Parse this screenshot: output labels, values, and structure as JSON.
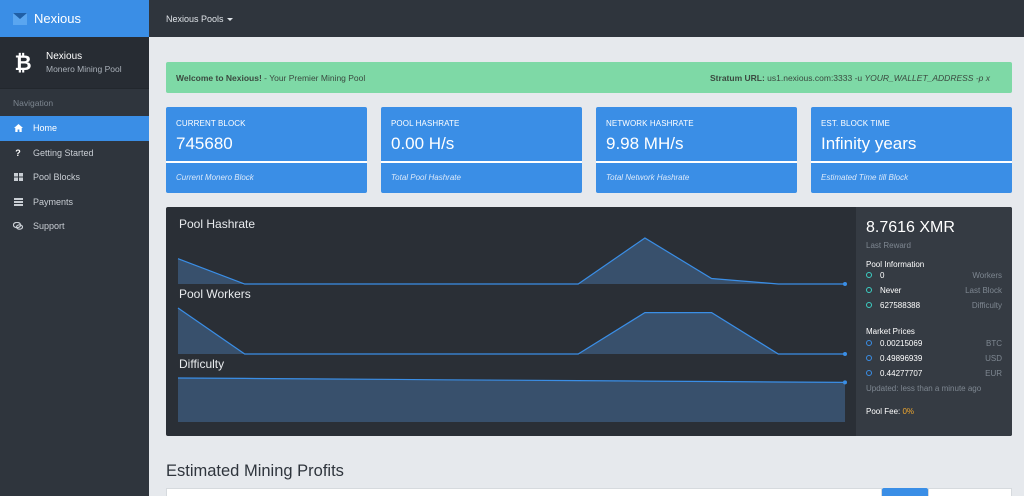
{
  "app": {
    "brand": "Nexious",
    "brand_icon": "logo-icon"
  },
  "profile": {
    "name": "Nexious",
    "subtitle": "Monero Mining Pool",
    "icon": "bitcoin-icon"
  },
  "nav": {
    "heading": "Navigation",
    "items": [
      {
        "label": "Home",
        "icon": "home-icon",
        "active": true
      },
      {
        "label": "Getting Started",
        "icon": "question-icon",
        "active": false
      },
      {
        "label": "Pool Blocks",
        "icon": "blocks-icon",
        "active": false
      },
      {
        "label": "Payments",
        "icon": "payments-icon",
        "active": false
      },
      {
        "label": "Support",
        "icon": "support-icon",
        "active": false
      }
    ]
  },
  "topbar": {
    "pools_label": "Nexious Pools"
  },
  "alert": {
    "welcome_bold": "Welcome to Nexious!",
    "welcome_text": " - Your Premier Mining Pool",
    "stratum_label": "Stratum URL:",
    "stratum_url": " us1.nexious.com:3333 -u ",
    "stratum_wallet": "YOUR_WALLET_ADDRESS",
    "stratum_tail": " -p x"
  },
  "cards": [
    {
      "title": "CURRENT BLOCK",
      "value": "745680",
      "footer": "Current Monero Block"
    },
    {
      "title": "POOL HASHRATE",
      "value": "0.00 H/s",
      "footer": "Total Pool Hashrate"
    },
    {
      "title": "NETWORK HASHRATE",
      "value": "9.98 MH/s",
      "footer": "Total Network Hashrate"
    },
    {
      "title": "EST. BLOCK TIME",
      "value": "Infinity years",
      "footer": "Estimated Time till Block"
    }
  ],
  "charts": {
    "titles": [
      "Pool Hashrate",
      "Pool Workers",
      "Difficulty"
    ]
  },
  "chart_data": [
    {
      "type": "area",
      "title": "Pool Hashrate",
      "values": [
        0.55,
        0,
        0,
        0,
        0,
        0,
        0,
        1,
        0.12,
        0,
        0
      ]
    },
    {
      "type": "area",
      "title": "Pool Workers",
      "values": [
        1,
        0,
        0,
        0,
        0,
        0,
        0,
        0.9,
        0.9,
        0,
        0
      ]
    },
    {
      "type": "area",
      "title": "Difficulty",
      "values": [
        1,
        0.99,
        0.98,
        0.97,
        0.96,
        0.95,
        0.94,
        0.93,
        0.92,
        0.91,
        0.9
      ]
    }
  ],
  "side": {
    "reward_value": "8.7616 XMR",
    "reward_label": "Last Reward",
    "pool_info_head": "Pool Information",
    "pool_info": [
      {
        "value": "0",
        "key": "Workers"
      },
      {
        "value": "Never",
        "key": "Last Block"
      },
      {
        "value": "627588388",
        "key": "Difficulty"
      }
    ],
    "market_head": "Market Prices",
    "market": [
      {
        "value": "0.00215069",
        "key": "BTC"
      },
      {
        "value": "0.49896939",
        "key": "USD"
      },
      {
        "value": "0.44277707",
        "key": "EUR"
      }
    ],
    "updated": "Updated: less than a minute ago",
    "fee_label": "Pool Fee: ",
    "fee_value": "0%"
  },
  "profits": {
    "title": "Estimated Mining Profits"
  },
  "colors": {
    "accent": "#3a8ee6",
    "sidebar": "#2f353d",
    "alert": "#7ed9a6",
    "fee": "#f0a82e",
    "teal": "#3ccfc4"
  }
}
